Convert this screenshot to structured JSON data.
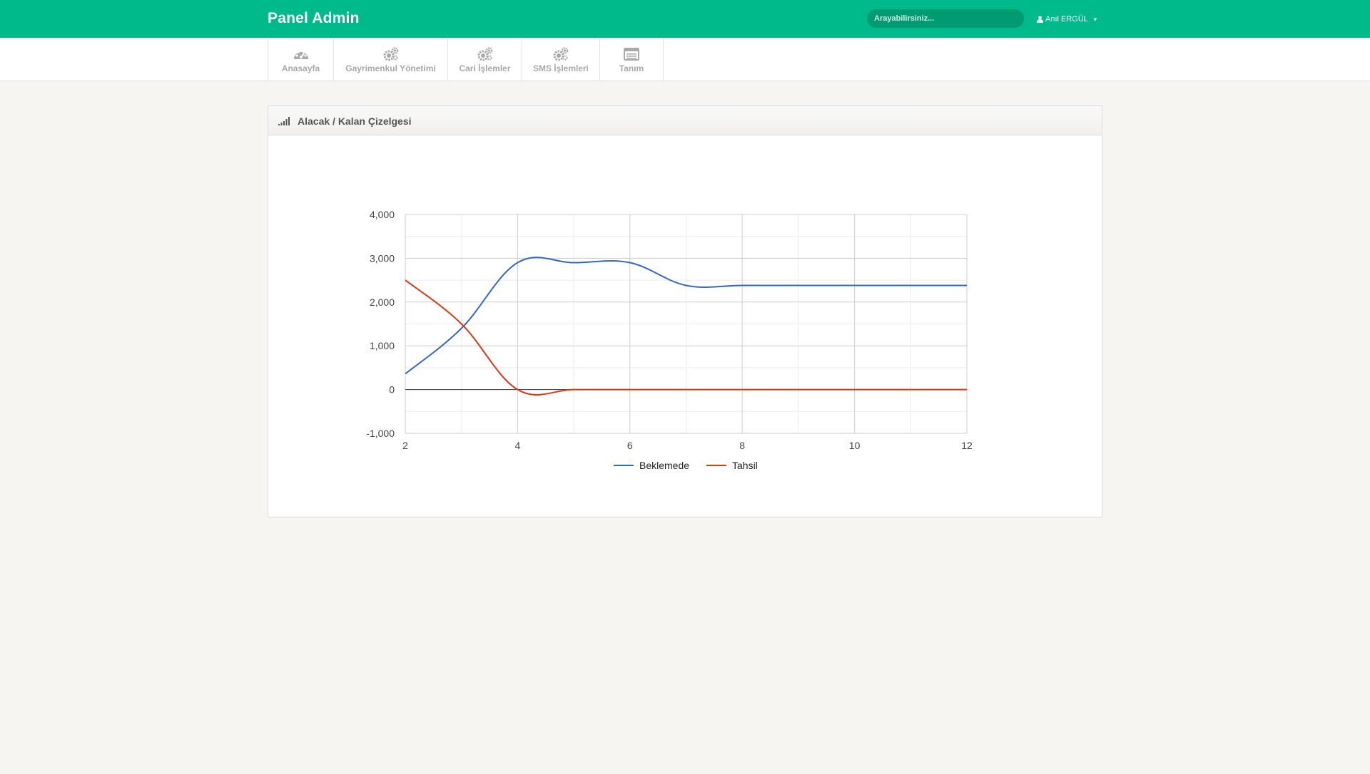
{
  "header": {
    "brand": "Panel Admin",
    "search_placeholder": "Arayabilirsiniz...",
    "user_name": "Anıl ERGÜL",
    "accent_color": "#00ba8b"
  },
  "nav": {
    "items": [
      {
        "label": "Anasayfa",
        "icon": "dashboard-icon"
      },
      {
        "label": "Gayrimenkul Yönetimi",
        "icon": "gears-icon"
      },
      {
        "label": "Cari İşlemler",
        "icon": "gears-icon"
      },
      {
        "label": "SMS İşlemleri",
        "icon": "gears-icon"
      },
      {
        "label": "Tanım",
        "icon": "list-icon"
      }
    ]
  },
  "panel": {
    "title": "Alacak / Kalan Çizelgesi",
    "icon": "signal-bars-icon"
  },
  "chart_data": {
    "type": "line",
    "title": "",
    "xlabel": "",
    "ylabel": "",
    "xlim": [
      2,
      12
    ],
    "ylim": [
      -1000,
      4000
    ],
    "x_ticks": [
      2,
      4,
      6,
      8,
      10,
      12
    ],
    "y_ticks": [
      -1000,
      0,
      1000,
      2000,
      3000,
      4000
    ],
    "y_tick_labels": [
      "-1,000",
      "0",
      "1,000",
      "2,000",
      "3,000",
      "4,000"
    ],
    "grid": true,
    "legend_position": "bottom",
    "series": [
      {
        "name": "Beklemede",
        "color": "#3366cc",
        "x": [
          2,
          3,
          4,
          5,
          6,
          7,
          8,
          9,
          10,
          11,
          12
        ],
        "y": [
          360,
          1400,
          2900,
          2900,
          2900,
          2380,
          2380,
          2380,
          2380,
          2380,
          2380
        ]
      },
      {
        "name": "Tahsil",
        "color": "#dc3912",
        "x": [
          2,
          3,
          4,
          5,
          6,
          7,
          8,
          9,
          10,
          11,
          12
        ],
        "y": [
          2500,
          1500,
          0,
          0,
          0,
          0,
          0,
          0,
          0,
          0,
          0
        ]
      }
    ]
  }
}
